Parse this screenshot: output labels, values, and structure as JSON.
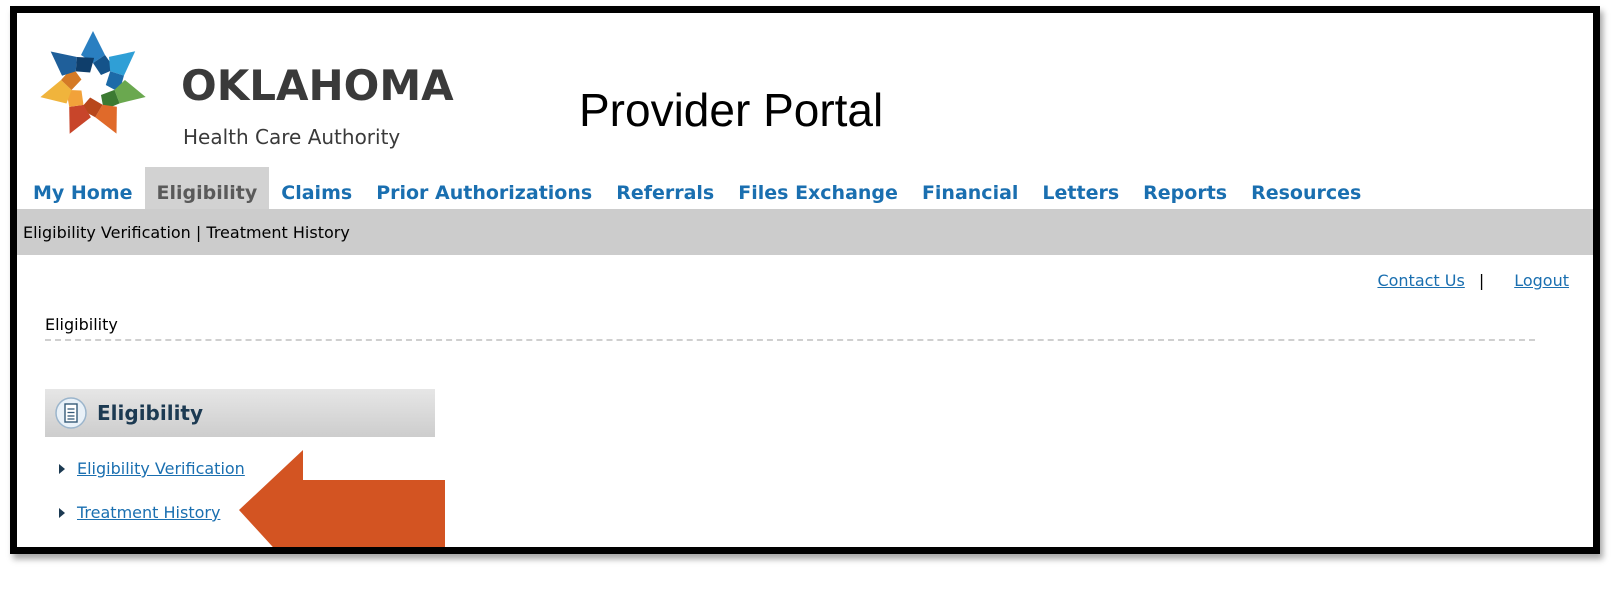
{
  "header": {
    "brand_name": "OKLAHOMA",
    "brand_subtitle": "Health Care Authority",
    "portal_title": "Provider Portal"
  },
  "main_nav": {
    "tabs": [
      {
        "label": "My Home",
        "active": false
      },
      {
        "label": "Eligibility",
        "active": true
      },
      {
        "label": "Claims",
        "active": false
      },
      {
        "label": "Prior Authorizations",
        "active": false
      },
      {
        "label": "Referrals",
        "active": false
      },
      {
        "label": "Files Exchange",
        "active": false
      },
      {
        "label": "Financial",
        "active": false
      },
      {
        "label": "Letters",
        "active": false
      },
      {
        "label": "Reports",
        "active": false
      },
      {
        "label": "Resources",
        "active": false
      }
    ]
  },
  "sub_nav": {
    "items": [
      "Eligibility Verification",
      "Treatment History"
    ],
    "separator": " | "
  },
  "utility_links": {
    "contact_us": "Contact Us",
    "separator": "|",
    "logout": "Logout"
  },
  "breadcrumb": "Eligibility",
  "panel": {
    "title": "Eligibility",
    "links": [
      "Eligibility Verification",
      "Treatment History"
    ]
  },
  "colors": {
    "link": "#1a6fb0",
    "active_tab_bg": "#d2d2d2",
    "subnav_bg": "#cccccc",
    "arrow": "#d35422"
  },
  "icons": {
    "panel_icon": "document-list-icon",
    "callout": "arrow-left-callout"
  }
}
